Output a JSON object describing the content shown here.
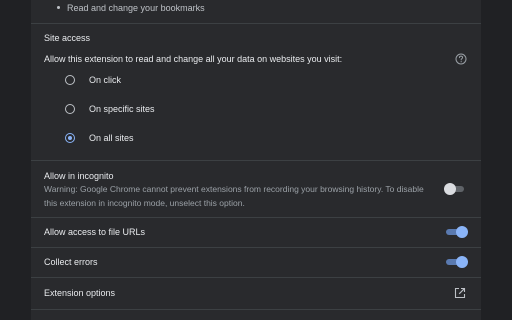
{
  "permissions": {
    "items": [
      "Read and change your bookmarks"
    ]
  },
  "site_access": {
    "title": "Site access",
    "description": "Allow this extension to read and change all your data on websites you visit:",
    "help_icon": "help-circle-icon",
    "options": [
      {
        "label": "On click",
        "selected": false
      },
      {
        "label": "On specific sites",
        "selected": false
      },
      {
        "label": "On all sites",
        "selected": true
      }
    ]
  },
  "incognito": {
    "title": "Allow in incognito",
    "warning": "Warning: Google Chrome cannot prevent extensions from recording your browsing history. To disable this extension in incognito mode, unselect this option.",
    "enabled": false
  },
  "file_urls": {
    "title": "Allow access to file URLs",
    "enabled": true
  },
  "collect_errors": {
    "title": "Collect errors",
    "enabled": true
  },
  "extension_options": {
    "title": "Extension options",
    "icon": "open-in-new-icon"
  },
  "colors": {
    "page_background": "#202124",
    "card_background": "#292a2d",
    "accent": "#8ab4f8",
    "text_primary": "#e8eaed",
    "text_secondary": "#9aa0a6"
  }
}
